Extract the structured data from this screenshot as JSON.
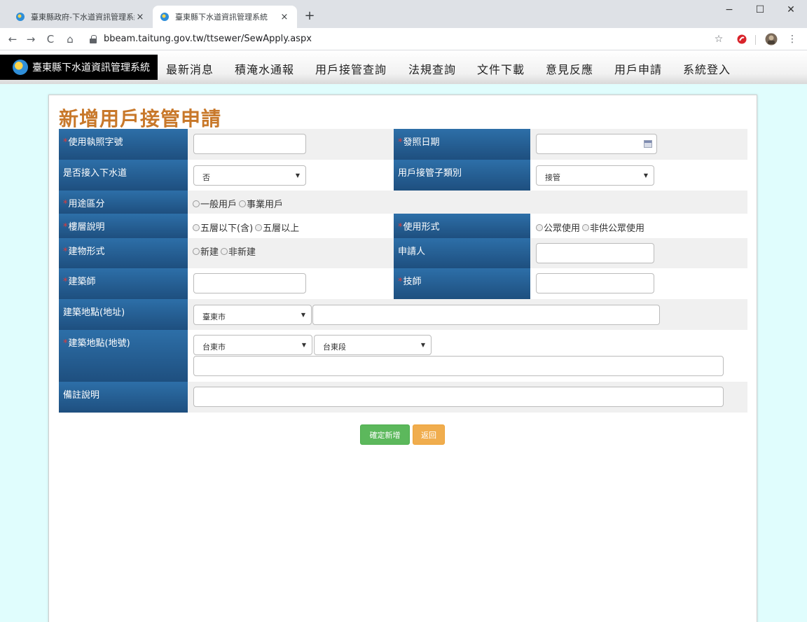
{
  "browser": {
    "tabs": [
      {
        "title": "臺東縣政府-下水道資訊管理系統",
        "close": "×"
      },
      {
        "title": "臺東縣下水道資訊管理系統",
        "close": "×"
      }
    ],
    "new_tab": "+",
    "window_controls": {
      "minimize": "−",
      "maximize": "☐",
      "close": "✕"
    },
    "nav": {
      "back": "←",
      "forward": "→",
      "reload": "C",
      "home": "⌂"
    },
    "url": "bbeam.taitung.gov.tw/ttsewer/SewApply.aspx",
    "right_icons": {
      "star": "☆",
      "more": "⋮"
    }
  },
  "site": {
    "brand": "臺東縣下水道資訊管理系統",
    "menu": [
      "最新消息",
      "積淹水通報",
      "用戶接管查詢",
      "法規查詢",
      "文件下載",
      "意見反應",
      "用戶申請",
      "系統登入"
    ]
  },
  "form": {
    "title": "新增用戶接管申請",
    "req_mark": "*",
    "license_no_label": "使用執照字號",
    "issue_date_label": "發照日期",
    "connect_label": "是否接入下水道",
    "connect_value": "否",
    "subtype_label": "用戶接管子類別",
    "subtype_value": "接管",
    "usage_label": "用途區分",
    "usage_options": [
      "一般用戶",
      "事業用戶"
    ],
    "floor_label": "樓層說明",
    "floor_options": [
      "五層以下(含)",
      "五層以上"
    ],
    "use_form_label": "使用形式",
    "use_form_options": [
      "公眾使用",
      "非供公眾使用"
    ],
    "building_label": "建物形式",
    "building_options": [
      "新建",
      "非新建"
    ],
    "applicant_label": "申請人",
    "architect_label": "建築師",
    "engineer_label": "技師",
    "address_label": "建築地點(地址)",
    "address_city": "臺東市",
    "lot_label": "建築地點(地號)",
    "lot_city": "台東市",
    "lot_section": "台東段",
    "remark_label": "備註說明",
    "submit": "確定新增",
    "back": "返回"
  }
}
